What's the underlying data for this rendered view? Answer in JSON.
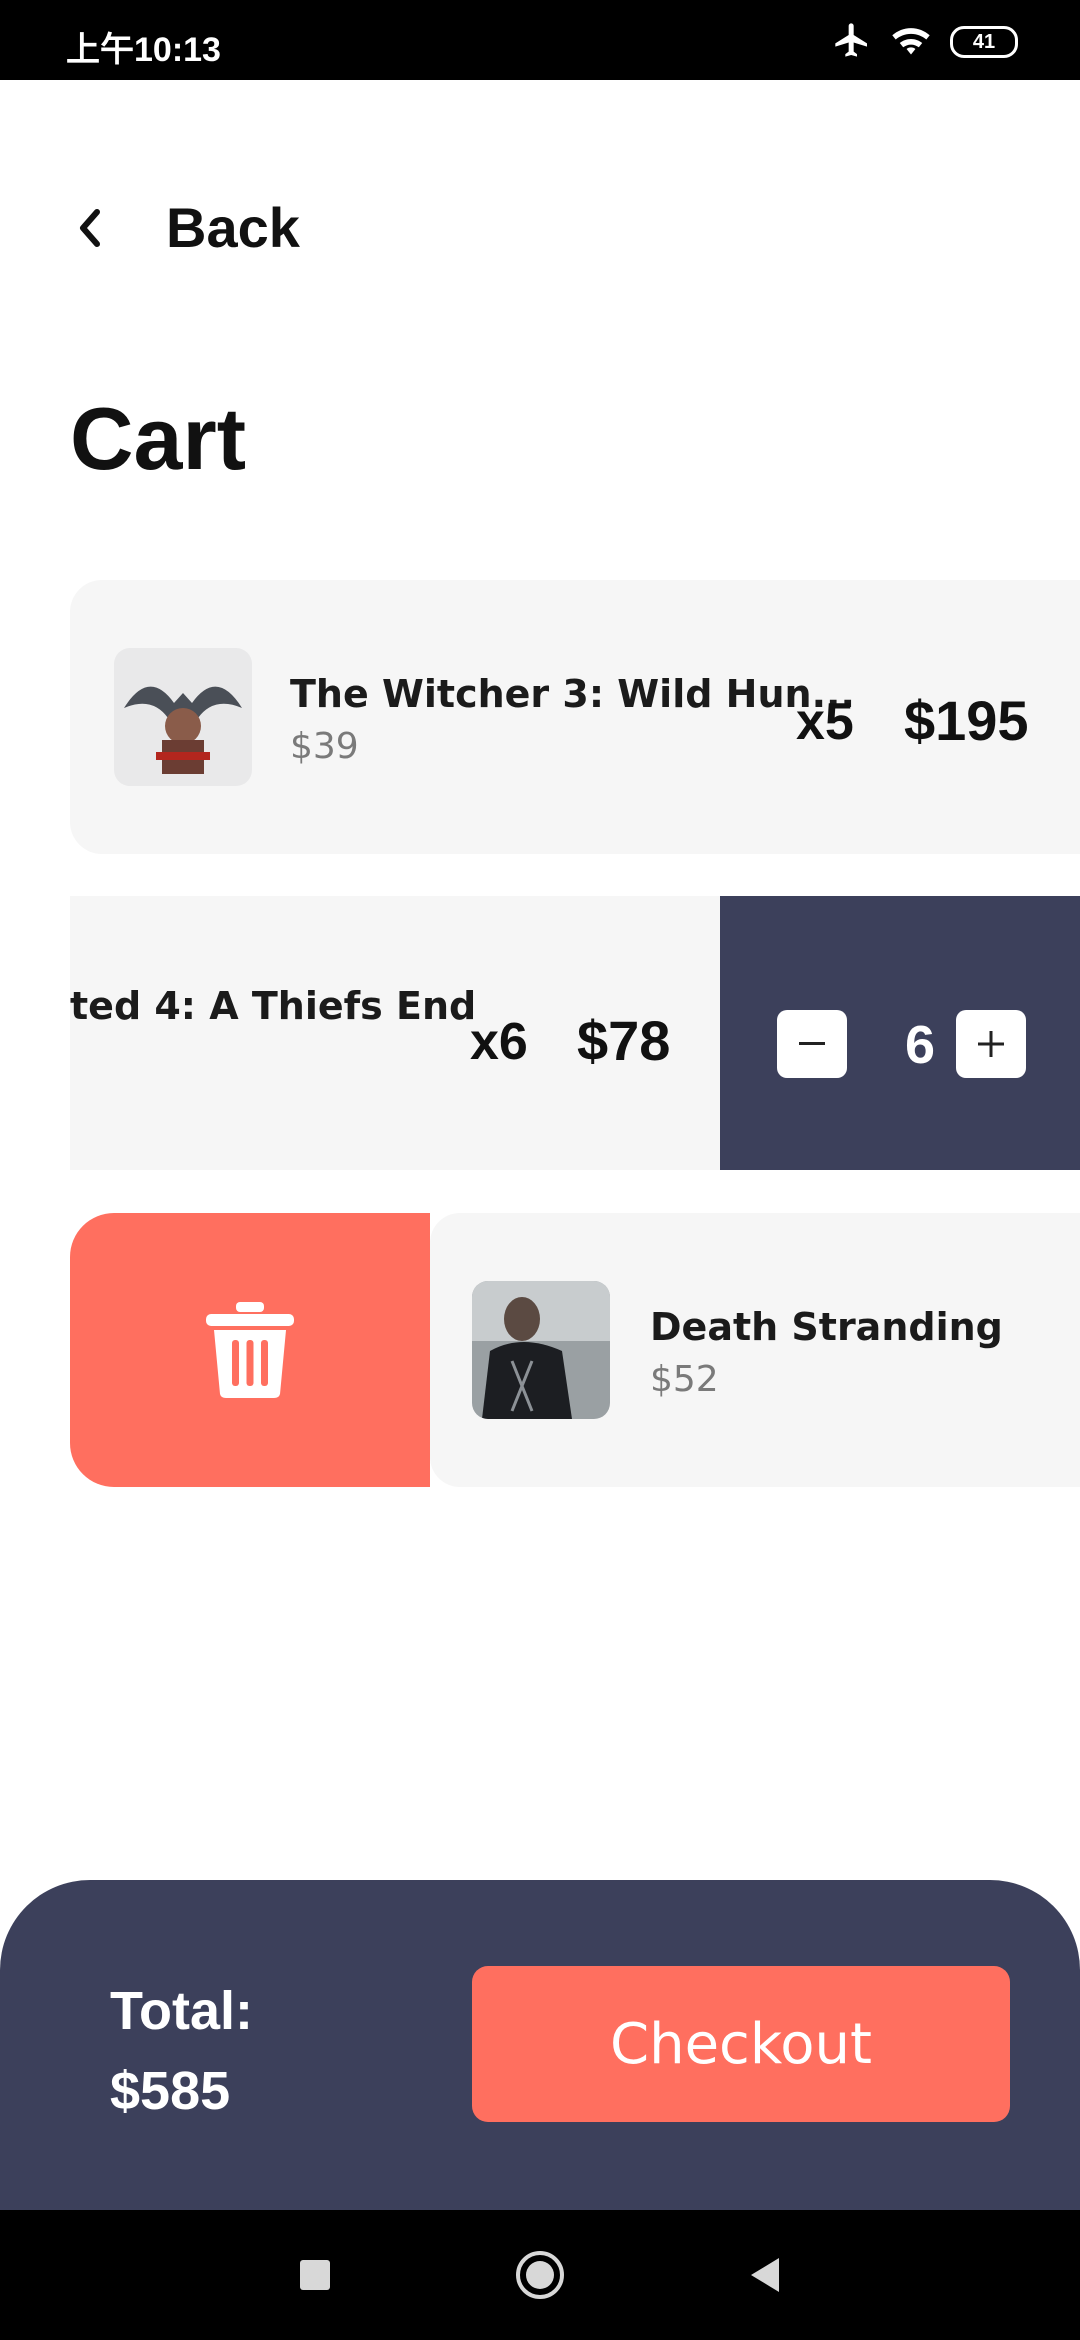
{
  "status_bar": {
    "time": "上午10:13",
    "battery": "41",
    "icons": [
      "airplane-icon",
      "wifi-icon",
      "battery-icon"
    ]
  },
  "header": {
    "back_label": "Back",
    "title": "Cart"
  },
  "cart": {
    "items": [
      {
        "name": "The Witcher 3: Wild Hun...",
        "price": "$39",
        "qty": "x5",
        "subtotal": "$195"
      },
      {
        "name": "ted 4: A Thiefs End",
        "qty": "x6",
        "subtotal": "$78",
        "stepper_value": "6"
      },
      {
        "name": "Death Stranding",
        "price": "$52"
      }
    ]
  },
  "checkout": {
    "total_label": "Total:",
    "total_value": "$585",
    "button_label": "Checkout"
  },
  "colors": {
    "accent": "#ff6f5f",
    "dark_panel": "#3c405b",
    "card_bg": "#f6f6f6"
  }
}
